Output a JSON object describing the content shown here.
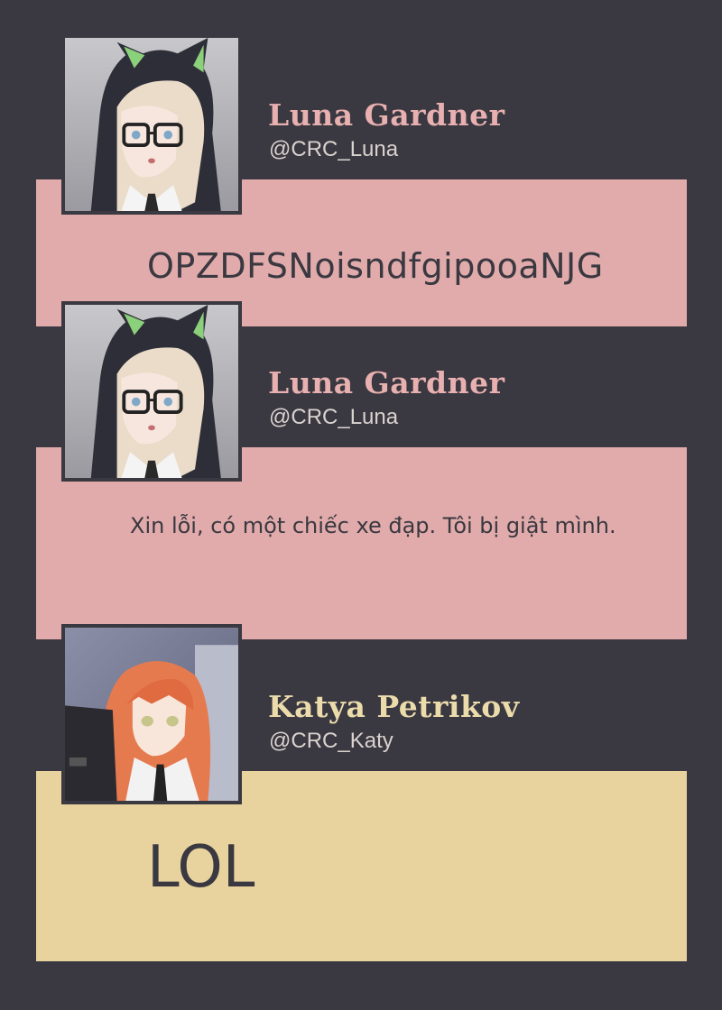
{
  "colors": {
    "background": "#3a3840",
    "luna_bubble": "#e1abab",
    "luna_name": "#e8b0b0",
    "katya_bubble": "#e8d39f",
    "katya_name": "#ecdcac",
    "text_dark": "#3a3840",
    "handle": "#d9d3cf"
  },
  "posts": [
    {
      "author": {
        "name": "Luna Gardner",
        "handle": "@CRC_Luna",
        "avatar": "luna-avatar-icon"
      },
      "message": "OPZDFSNoisndfgipooaNJG"
    },
    {
      "author": {
        "name": "Luna Gardner",
        "handle": "@CRC_Luna",
        "avatar": "luna-avatar-icon"
      },
      "message": "Xin lỗi, có một chiếc xe đạp. Tôi bị giật mình."
    },
    {
      "author": {
        "name": "Katya Petrikov",
        "handle": "@CRC_Katy",
        "avatar": "katya-avatar-icon"
      },
      "message": "LOL"
    }
  ]
}
